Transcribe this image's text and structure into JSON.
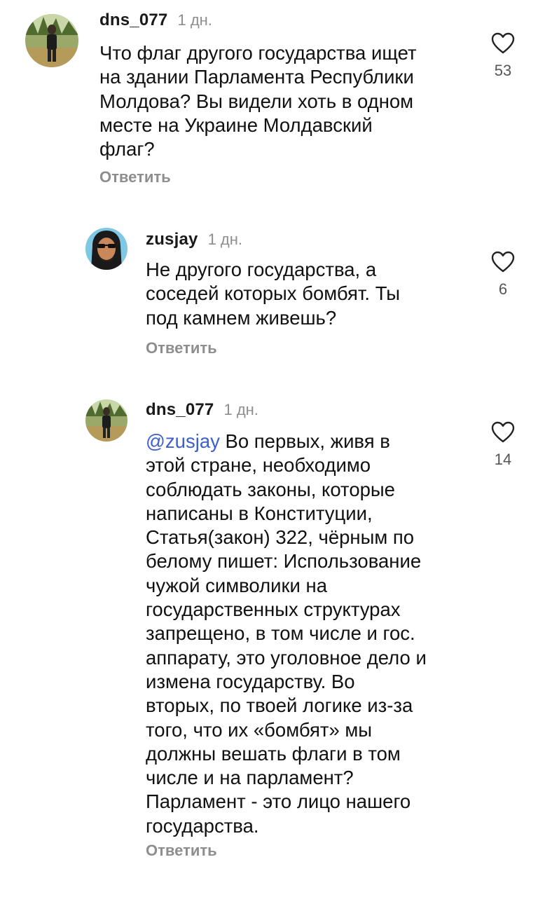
{
  "comments": [
    {
      "username": "dns_077",
      "time": "1 дн.",
      "text": "Что флаг другого государства ищет\nна здании Парламента Республики\nМолдова? Вы видели хоть в одном\nместе на Украине Молдавский\nфлаг?",
      "reply_label": "Ответить",
      "likes": "53",
      "avatar_icon": "landscape-person-avatar"
    },
    {
      "username": "zusjay",
      "time": "1 дн.",
      "text": "Не другого государства, а\nсоседей которых бомбят. Ты\nпод камнем живешь?",
      "reply_label": "Ответить",
      "likes": "6",
      "avatar_icon": "bearded-man-sunglasses-avatar"
    },
    {
      "username": "dns_077",
      "time": "1 дн.",
      "mention": "@zusjay",
      "text": " Во первых, живя в\nэтой стране, необходимо\nсоблюдать законы, которые\nнаписаны в Конституции,\nСтатья(закон) 322, чёрным по\nбелому пишет: Использование\nчужой символики на\nгосударственных структурах\nзапрещено, в том числе и гос.\nаппарату, это уголовное дело и\nизмена государству. Во\nвторых, по твоей логике из-за\nтого, что их «бомбят»  мы\nдолжны вешать флаги в том\nчисле  и на парламент?\nПарламент - это лицо нашего\nгосударства.",
      "reply_label": "Ответить",
      "likes": "14",
      "avatar_icon": "landscape-person-avatar"
    }
  ],
  "colors": {
    "text": "#111111",
    "secondary": "#8e8e8e",
    "mention": "#3e5fcf",
    "background": "#ffffff"
  },
  "icons": {
    "like": "heart-outline-icon"
  }
}
